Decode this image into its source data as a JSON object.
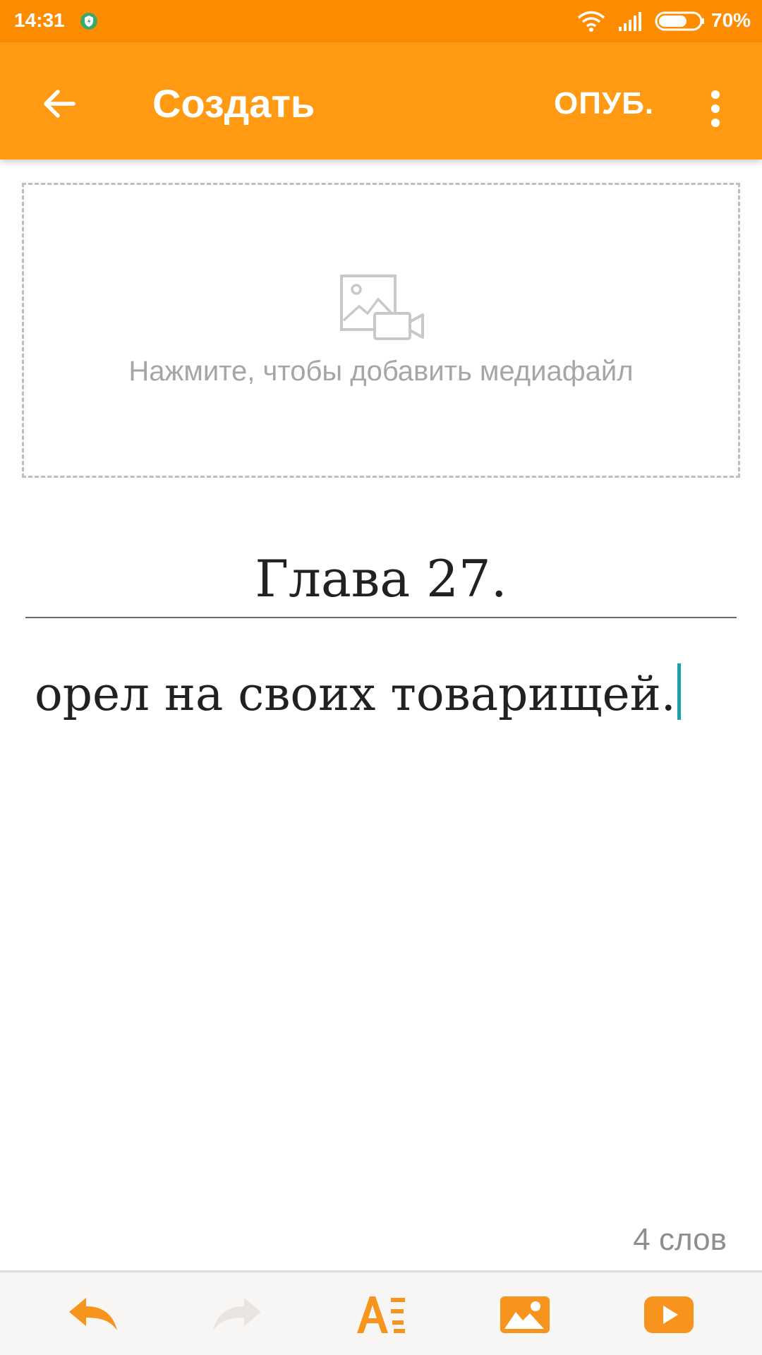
{
  "status_bar": {
    "time": "14:31",
    "battery_percent": "70%",
    "battery_level": 0.7,
    "icons": [
      "shield-icon",
      "wifi-icon",
      "signal-icon",
      "battery-icon"
    ]
  },
  "app_bar": {
    "title": "Создать",
    "publish_label": "ОПУБ.",
    "icons": [
      "back-arrow-icon",
      "more-vert-icon"
    ],
    "color": "#ff9a12"
  },
  "media": {
    "hint": "Нажмите, чтобы добавить медиафайл",
    "icon": "image-video-icon"
  },
  "editor": {
    "chapter_title": "Глава 27.",
    "body_text": "орел на своих товарищей.",
    "cursor_color": "#1aa0a8"
  },
  "footer": {
    "word_count": "4 слов"
  },
  "toolbar": {
    "buttons": [
      {
        "icon": "undo-icon",
        "enabled": true
      },
      {
        "icon": "redo-icon",
        "enabled": false
      },
      {
        "icon": "text-format-icon",
        "enabled": true
      },
      {
        "icon": "insert-image-icon",
        "enabled": true
      },
      {
        "icon": "insert-video-icon",
        "enabled": true
      }
    ],
    "accent_color": "#f7941d"
  }
}
